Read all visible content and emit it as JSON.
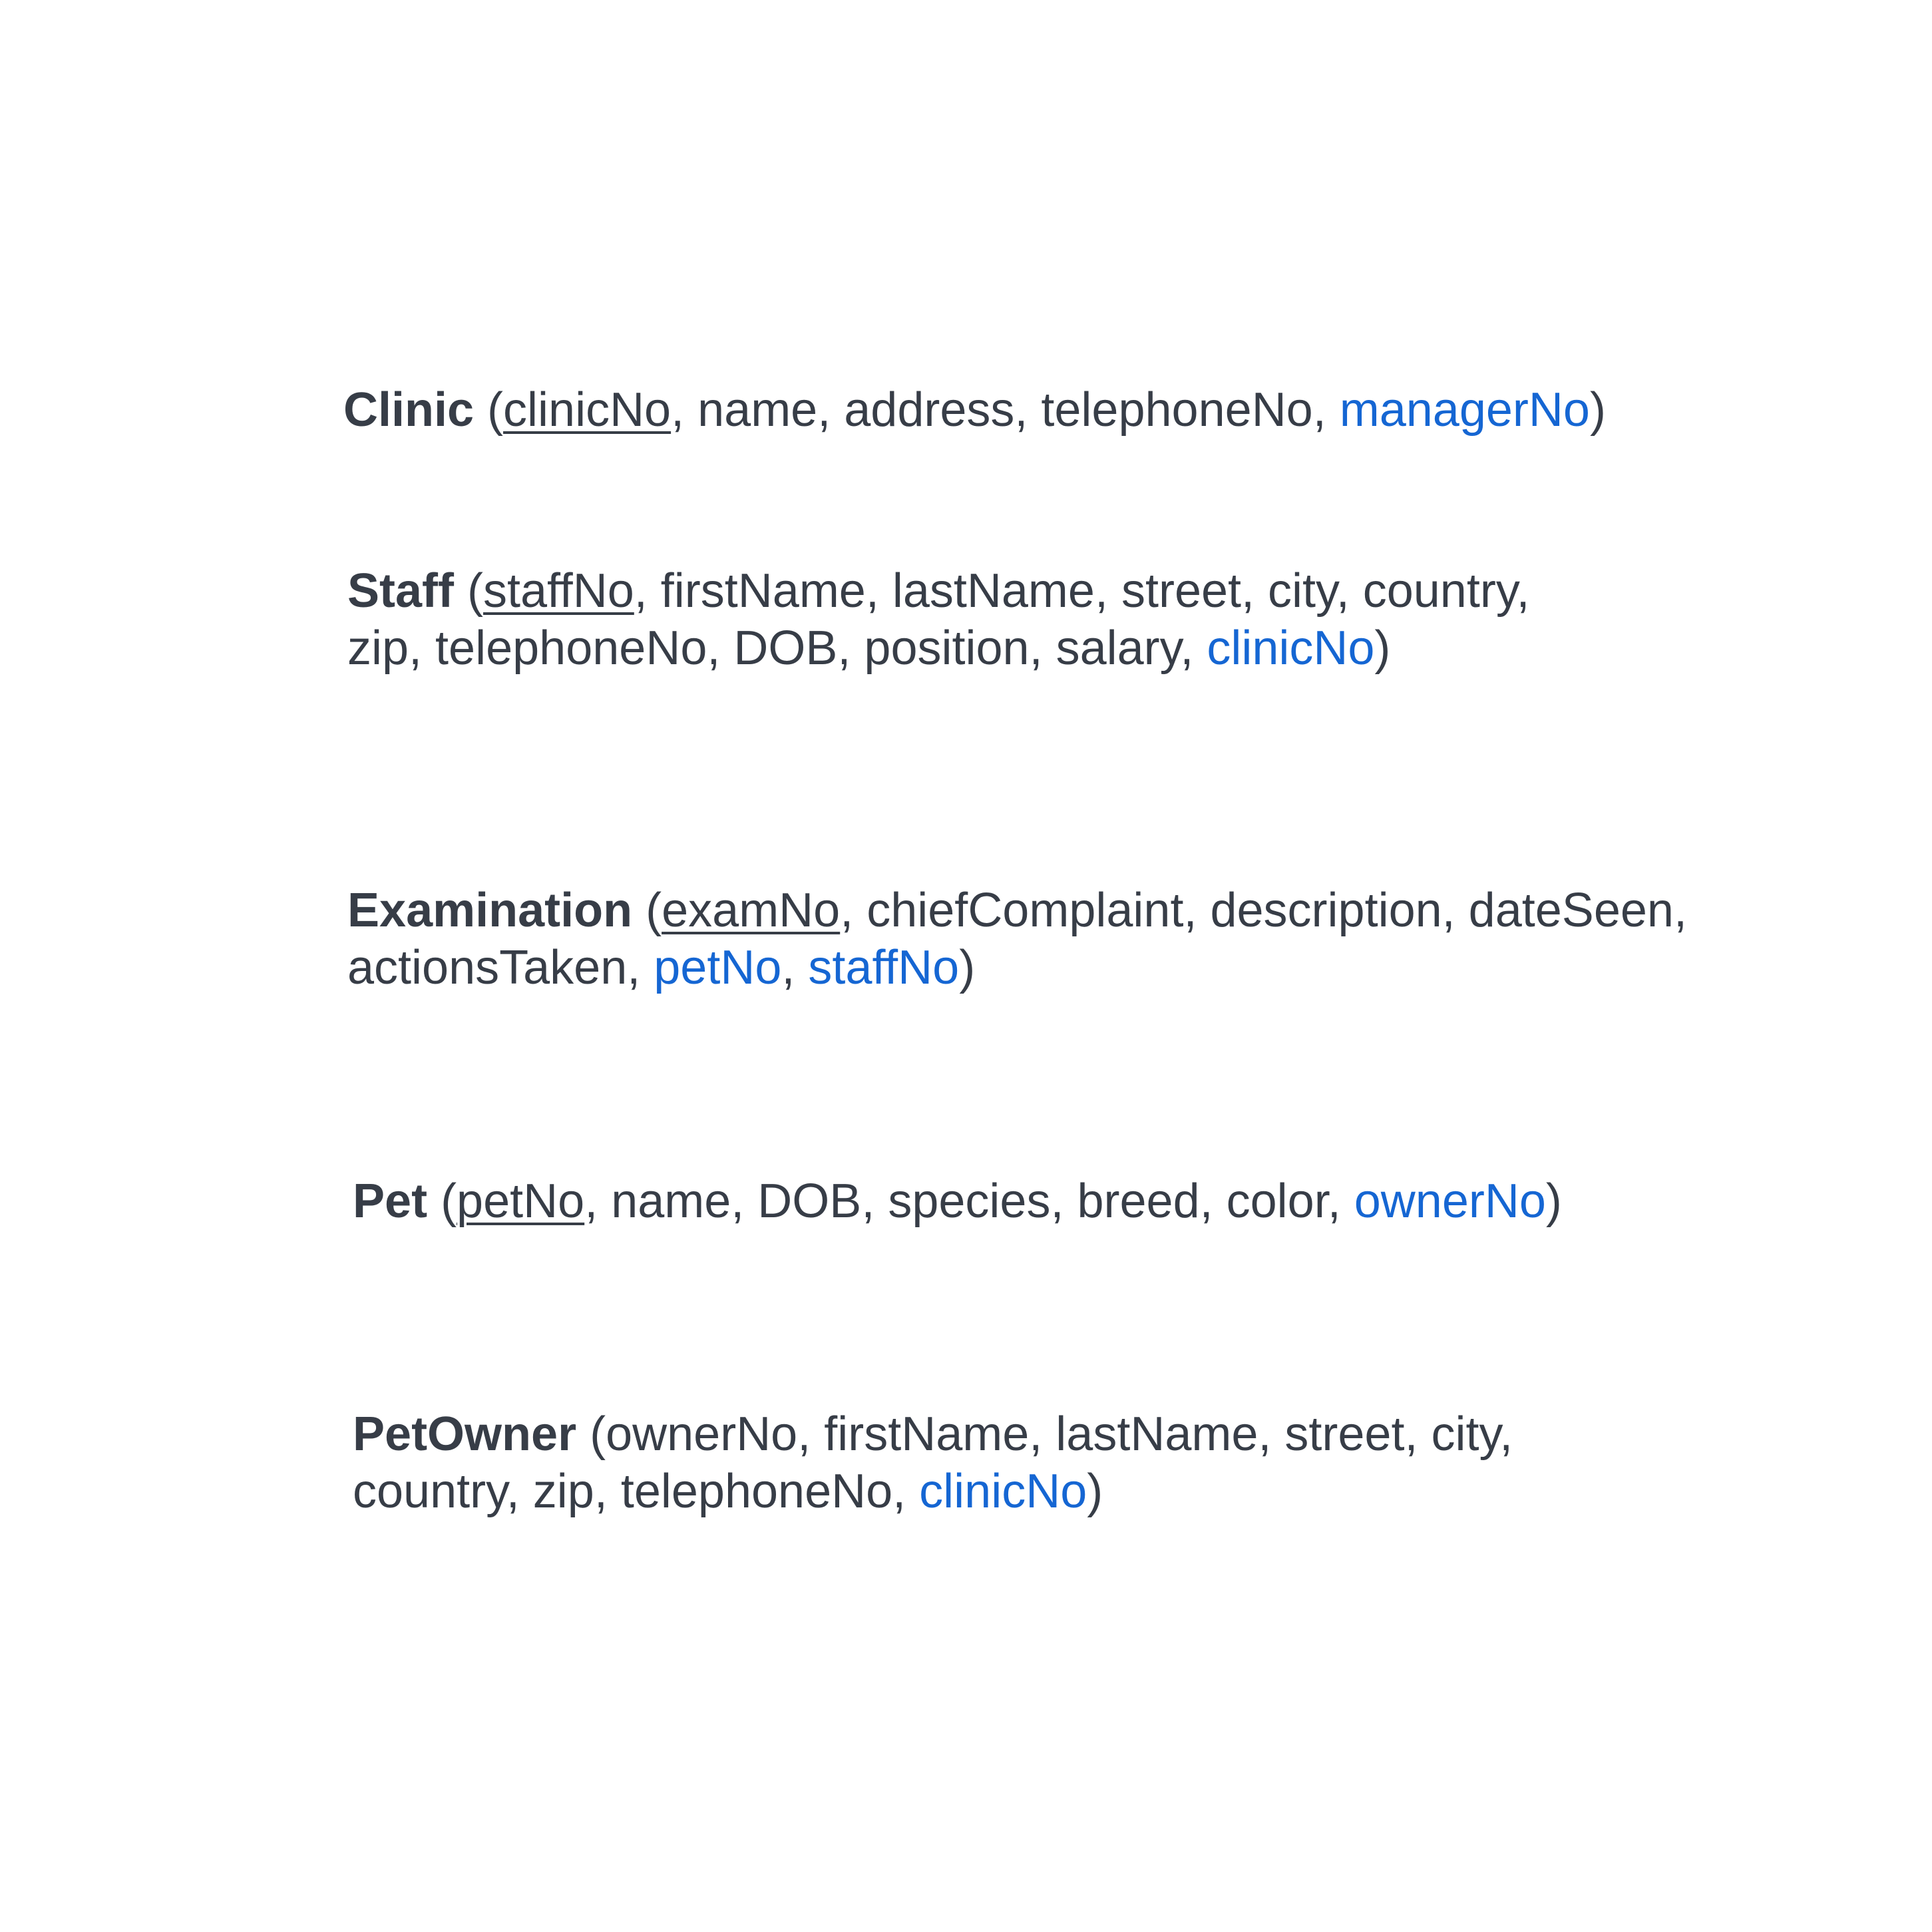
{
  "relations": [
    {
      "name": "Clinic",
      "lines": [
        [
          {
            "text": "(",
            "role": "plain"
          },
          {
            "text": "clinicNo",
            "role": "pk"
          },
          {
            "text": ", name, address, telephoneNo, ",
            "role": "plain"
          },
          {
            "text": "managerNo",
            "role": "fk"
          },
          {
            "text": ")",
            "role": "plain"
          }
        ]
      ]
    },
    {
      "name": "Staff",
      "lines": [
        [
          {
            "text": "(",
            "role": "plain"
          },
          {
            "text": "staffNo",
            "role": "pk"
          },
          {
            "text": ", firstName, lastName, street, city, country,",
            "role": "plain"
          }
        ],
        [
          {
            "text": "zip, telephoneNo, DOB, position, salary, ",
            "role": "plain"
          },
          {
            "text": "clinicNo",
            "role": "fk"
          },
          {
            "text": ")",
            "role": "plain"
          }
        ]
      ]
    },
    {
      "name": "Examination",
      "lines": [
        [
          {
            "text": "(",
            "role": "plain"
          },
          {
            "text": "examNo",
            "role": "pk"
          },
          {
            "text": ", chiefComplaint, description, dateSeen,",
            "role": "plain"
          }
        ],
        [
          {
            "text": "actionsTaken, ",
            "role": "plain"
          },
          {
            "text": "petNo",
            "role": "fk"
          },
          {
            "text": ", ",
            "role": "plain"
          },
          {
            "text": "staffNo",
            "role": "fk"
          },
          {
            "text": ")",
            "role": "plain"
          }
        ]
      ]
    },
    {
      "name": "Pet",
      "lines": [
        [
          {
            "text": "(",
            "role": "plain"
          },
          {
            "text": "petNo",
            "role": "pk"
          },
          {
            "text": ", name, DOB, species, breed, color, ",
            "role": "plain"
          },
          {
            "text": "ownerNo",
            "role": "fk"
          },
          {
            "text": ")",
            "role": "plain"
          }
        ]
      ]
    },
    {
      "name": "PetOwner",
      "lines": [
        [
          {
            "text": "(ownerNo, firstName, lastName, street, city,",
            "role": "plain"
          }
        ],
        [
          {
            "text": "country, zip, telephoneNo, ",
            "role": "plain"
          },
          {
            "text": "clinicNo",
            "role": "fk"
          },
          {
            "text": ")",
            "role": "plain"
          }
        ]
      ]
    }
  ],
  "colors": {
    "text": "#373d47",
    "foreign_key": "#1566d3",
    "background": "#ffffff"
  }
}
